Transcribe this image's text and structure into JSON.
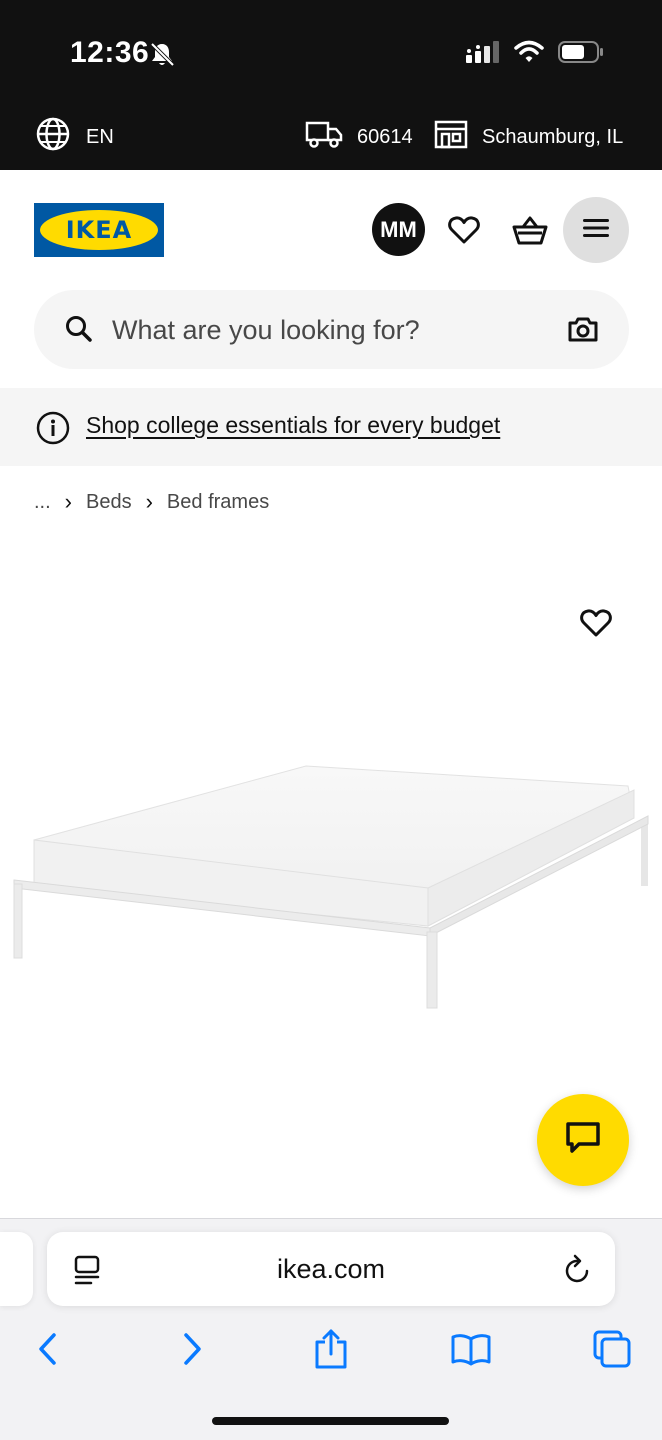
{
  "status_bar": {
    "time": "12:36",
    "icons": [
      "bell-slash-icon",
      "cellular-signal-icon",
      "wifi-icon",
      "battery-icon"
    ]
  },
  "locale_bar": {
    "language": "EN",
    "zip_code": "60614",
    "store": "Schaumburg, IL",
    "icons": [
      "globe-icon",
      "delivery-truck-icon",
      "store-icon"
    ]
  },
  "header": {
    "logo_text": "IKEA",
    "avatar_initials": "MM",
    "icons": [
      "heart-icon",
      "basket-icon",
      "hamburger-menu-icon"
    ]
  },
  "search": {
    "placeholder": "What are you looking for?",
    "icons": [
      "search-icon",
      "camera-icon"
    ]
  },
  "promo": {
    "link_text": "Shop college essentials for every budget"
  },
  "breadcrumb": {
    "ellipsis": "...",
    "items": [
      "Beds",
      "Bed frames"
    ]
  },
  "product": {
    "image_alt": "white metal bed frame with mattress",
    "icons": [
      "favorite-heart-icon",
      "chat-icon"
    ]
  },
  "browser": {
    "url": "ikea.com",
    "icons": [
      "reader-icon",
      "reload-icon",
      "back-icon",
      "forward-icon",
      "share-icon",
      "bookmarks-icon",
      "tabs-icon"
    ]
  },
  "colors": {
    "ikea_blue": "#0058a3",
    "ikea_yellow": "#ffdb00",
    "dark_bar": "#111111",
    "safari_blue": "#0a7aff"
  }
}
